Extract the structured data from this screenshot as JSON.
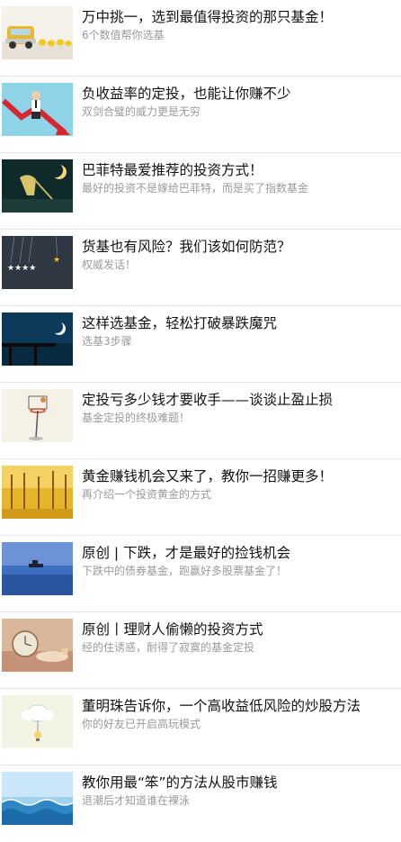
{
  "articles": [
    {
      "title": "万中挑一，选到最值得投资的那只基金！",
      "subtitle": "6个数值帮你选基"
    },
    {
      "title": "负收益率的定投，也能让你赚不少",
      "subtitle": "双剑合璧的威力更是无穷"
    },
    {
      "title": "巴菲特最爱推荐的投资方式！",
      "subtitle": "最好的投资不是嫁给巴菲特，而是买了指数基金"
    },
    {
      "title": "货基也有风险？我们该如何防范？",
      "subtitle": "权威发话！"
    },
    {
      "title": "这样选基金，轻松打破暴跌魔咒",
      "subtitle": "选基3步骤"
    },
    {
      "title": "定投亏多少钱才要收手——谈谈止盈止损",
      "subtitle": "基金定投的终极难题！"
    },
    {
      "title": "黄金赚钱机会又来了，教你一招赚更多！",
      "subtitle": "再介绍一个投资黄金的方式"
    },
    {
      "title": "原创 | 下跌，才是最好的捡钱机会",
      "subtitle": "下跌中的债券基金，跑赢好多股票基金了！"
    },
    {
      "title": "原创丨理财人偷懒的投资方式",
      "subtitle": "经的住诱惑，耐得了寂寞的基金定投"
    },
    {
      "title": "董明珠告诉你，一个高收益低风险的炒股方法",
      "subtitle": "你的好友已开启高玩模式"
    },
    {
      "title": "教你用最“笨”的方法从股市赚钱",
      "subtitle": "退潮后才知道谁在裸泳"
    }
  ]
}
